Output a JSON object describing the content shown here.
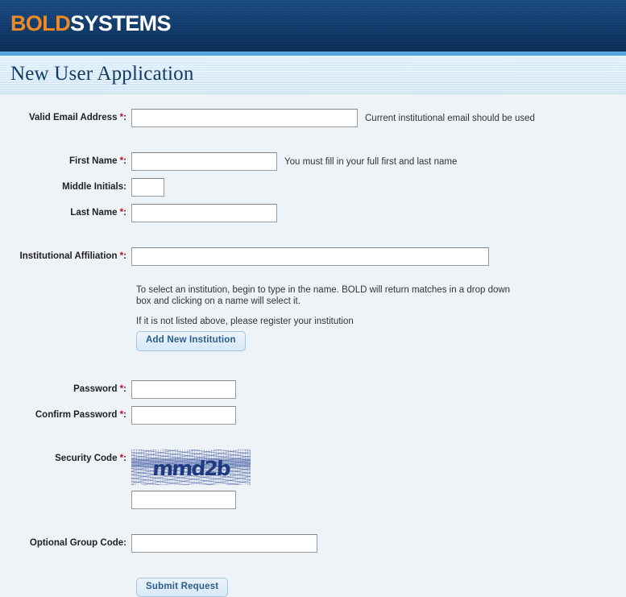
{
  "header": {
    "logo_bold": "BOLD",
    "logo_systems": "SYSTEMS",
    "brand_orange": "#f08a24",
    "brand_navy": "#113a6b",
    "accent_blue": "#56a5e0"
  },
  "page": {
    "title": "New User Application",
    "background": "#eef3f8"
  },
  "form": {
    "fields": {
      "email": {
        "label": "Valid Email Address",
        "required_mark": "*",
        "colon": ":",
        "value": "",
        "hint": "Current institutional email should be used"
      },
      "first_name": {
        "label": "First Name",
        "required_mark": "*",
        "colon": ":",
        "value": "",
        "hint": "You must fill in your full first and last name"
      },
      "middle_initials": {
        "label": "Middle Initials",
        "colon": ":",
        "value": ""
      },
      "last_name": {
        "label": "Last Name",
        "required_mark": "*",
        "colon": ":",
        "value": ""
      },
      "institution": {
        "label": "Institutional Affiliation",
        "required_mark": "*",
        "colon": ":",
        "value": ""
      },
      "password": {
        "label": "Password",
        "required_mark": "*",
        "colon": ":",
        "value": ""
      },
      "confirm_password": {
        "label": "Confirm Password",
        "required_mark": "*",
        "colon": ":",
        "value": ""
      },
      "security_code": {
        "label": "Security Code",
        "required_mark": "*",
        "colon": ":",
        "value": ""
      },
      "group_code": {
        "label": "Optional Group Code",
        "colon": ":",
        "value": ""
      }
    },
    "institution_help": {
      "line1": "To select an institution, begin to type in the name. BOLD will return matches in a drop down box and clicking on a name will select it.",
      "line2": "If it is not listed above, please register your institution",
      "add_button": "Add New Institution"
    },
    "captcha": {
      "code_text": "mmd2b",
      "text_color": "#1f3a80"
    },
    "submit_button": "Submit Request",
    "required_color": "#d0021b"
  }
}
